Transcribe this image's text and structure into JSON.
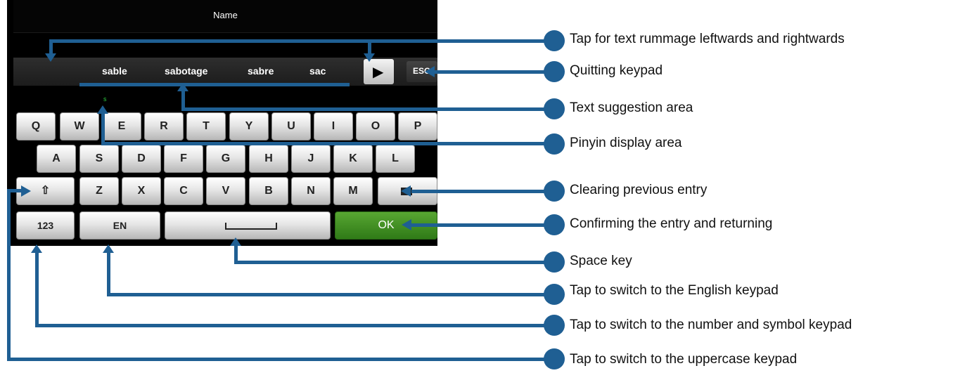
{
  "screen": {
    "title": "Name",
    "suggestions": [
      "sable",
      "sabotage",
      "sabre",
      "sac"
    ],
    "esc_label": "ESC",
    "pinyin_text": "s",
    "keyboard": {
      "row1": [
        "Q",
        "W",
        "E",
        "R",
        "T",
        "Y",
        "U",
        "I",
        "O",
        "P"
      ],
      "row2": [
        "A",
        "S",
        "D",
        "F",
        "G",
        "H",
        "J",
        "K",
        "L"
      ],
      "row3": [
        "Z",
        "X",
        "C",
        "V",
        "B",
        "N",
        "M"
      ],
      "numbers_label": "123",
      "language_label": "EN",
      "ok_label": "OK"
    }
  },
  "callouts": [
    "Tap for text rummage leftwards and rightwards",
    "Quitting keypad",
    "Text suggestion area",
    "Pinyin display area",
    "Clearing previous entry",
    "Confirming the entry and returning",
    "Space key",
    "Tap to switch to the English keypad",
    "Tap to switch to the number and symbol keypad",
    "Tap to switch to the uppercase keypad"
  ],
  "colors": {
    "callout": "#1f5f93",
    "ok_key": "#3f8f22",
    "pinyin": "#2ecc40"
  }
}
